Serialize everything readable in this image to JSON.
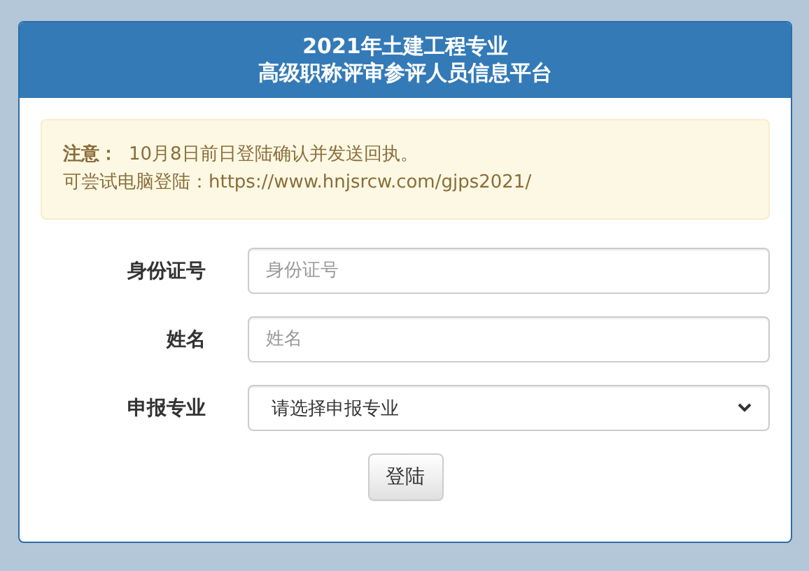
{
  "header": {
    "title_line_1": "2021年土建工程专业",
    "title_line_2": "高级职称评审参评人员信息平台"
  },
  "notice": {
    "label": "注意：",
    "text": "10月8日前日登陆确认并发送回执。",
    "line_2": "可尝试电脑登陆：https://www.hnjsrcw.com/gjps2021/"
  },
  "fields": [
    {
      "kind": "input",
      "label": "身份证号",
      "placeholder": "身份证号"
    },
    {
      "kind": "input",
      "label": "姓名",
      "placeholder": "姓名"
    },
    {
      "kind": "select",
      "label": "申报专业",
      "value": "请选择申报专业"
    }
  ],
  "button": "登陆"
}
